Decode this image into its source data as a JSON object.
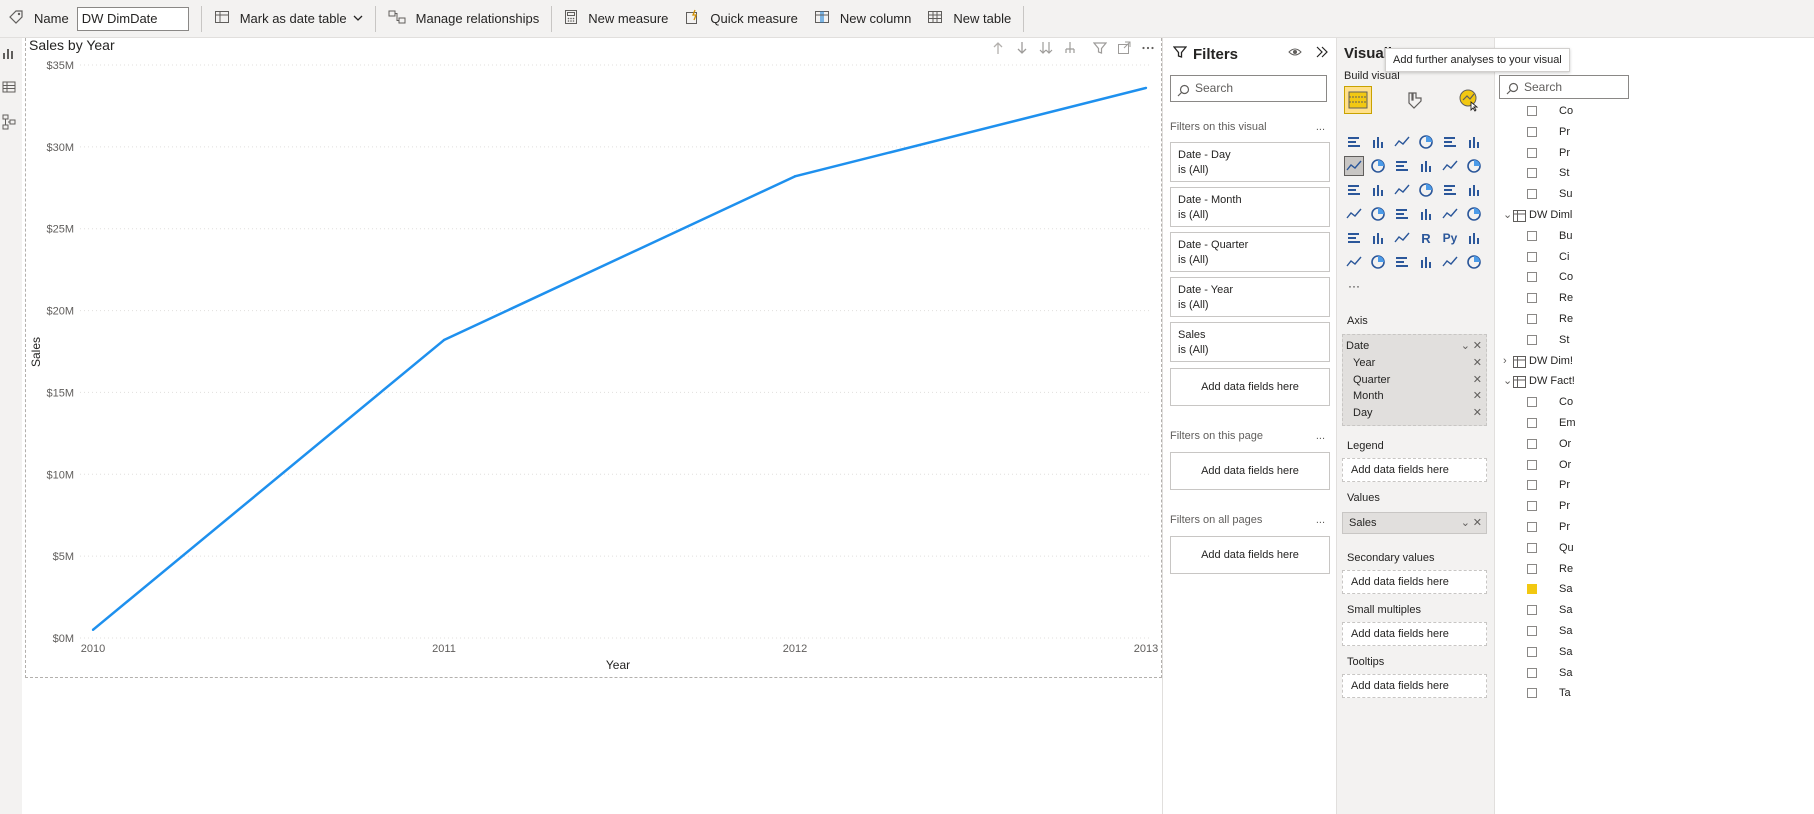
{
  "toolbar": {
    "name_label": "Name",
    "name_value": "DW DimDate",
    "mark_date_table": "Mark as date table",
    "manage_relationships": "Manage relationships",
    "new_measure": "New measure",
    "quick_measure": "Quick measure",
    "new_column": "New column",
    "new_table": "New table"
  },
  "chart": {
    "title": "Sales by Year",
    "line_color": "#1e90ee"
  },
  "chart_data": {
    "type": "line",
    "title": "Sales by Year",
    "xlabel": "Year",
    "ylabel": "Sales",
    "x": [
      "2010",
      "2011",
      "2012",
      "2013"
    ],
    "series": [
      {
        "values": [
          0.5,
          18.2,
          28.2,
          33.6
        ]
      }
    ],
    "ylim": [
      0,
      35
    ],
    "y_ticks": [
      "$0M",
      "$5M",
      "$10M",
      "$15M",
      "$20M",
      "$25M",
      "$30M",
      "$35M"
    ],
    "grid": true
  },
  "filters": {
    "title": "Filters",
    "search_placeholder": "Search",
    "on_visual": "Filters on this visual",
    "on_page": "Filters on this page",
    "on_all_pages": "Filters on all pages",
    "more": "...",
    "cards": [
      {
        "name": "Date - Day",
        "state": "is (All)"
      },
      {
        "name": "Date - Month",
        "state": "is (All)"
      },
      {
        "name": "Date - Quarter",
        "state": "is (All)"
      },
      {
        "name": "Date - Year",
        "state": "is (All)"
      },
      {
        "name": "Sales",
        "state": "is (All)"
      }
    ],
    "add_fields": "Add data fields here"
  },
  "viz": {
    "title": "Visuali",
    "build_visual": "Build visual",
    "tooltip": "Add further analyses to your visual",
    "axis": "Axis",
    "axis_field": "Date",
    "axis_sub": [
      "Year",
      "Quarter",
      "Month",
      "Day"
    ],
    "legend": "Legend",
    "values": "Values",
    "values_field": "Sales",
    "secondary_values": "Secondary values",
    "small_multiples": "Small multiples",
    "tooltips": "Tooltips",
    "add_fields": "Add data fields here",
    "r_label": "R",
    "py_label": "Py",
    "more": "···"
  },
  "fields": {
    "search_placeholder": "Search",
    "rows": [
      {
        "text": "Co",
        "checked": false
      },
      {
        "text": "Pr",
        "checked": false
      },
      {
        "text": "Pr",
        "checked": false
      },
      {
        "text": "St",
        "checked": false
      },
      {
        "text": "Su",
        "checked": false
      },
      {
        "text": "DW Diml",
        "checked": false
      },
      {
        "text": "Bu",
        "checked": false
      },
      {
        "text": "Ci",
        "checked": false
      },
      {
        "text": "Co",
        "checked": false
      },
      {
        "text": "Re",
        "checked": false
      },
      {
        "text": "Re",
        "checked": false
      },
      {
        "text": "St",
        "checked": false
      },
      {
        "text": "DW Dim!",
        "checked": false
      },
      {
        "text": "DW Fact!",
        "checked": false
      },
      {
        "text": "Co",
        "checked": false
      },
      {
        "text": "Em",
        "checked": false
      },
      {
        "text": "Or",
        "checked": false
      },
      {
        "text": "Or",
        "checked": false
      },
      {
        "text": "Pr",
        "checked": false
      },
      {
        "text": "Pr",
        "checked": false
      },
      {
        "text": "Pr",
        "checked": false
      },
      {
        "text": "Qu",
        "checked": false
      },
      {
        "text": "Re",
        "checked": false
      },
      {
        "text": "Sa",
        "checked": true
      },
      {
        "text": "Sa",
        "checked": false
      },
      {
        "text": "Sa",
        "checked": false
      },
      {
        "text": "Sa",
        "checked": false
      },
      {
        "text": "Sa",
        "checked": false
      },
      {
        "text": "Ta",
        "checked": false
      }
    ]
  }
}
